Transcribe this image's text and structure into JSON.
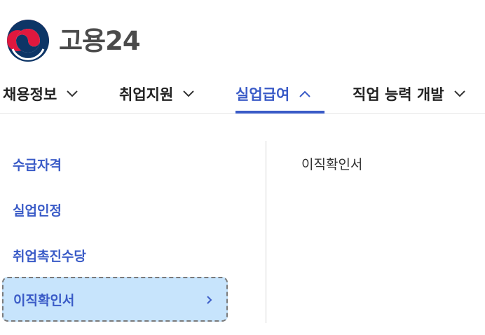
{
  "logo": {
    "text": "고용24"
  },
  "nav": {
    "items": [
      {
        "label": "채용정보",
        "icon": "chevron-down-icon"
      },
      {
        "label": "취업지원",
        "icon": "chevron-down-icon"
      },
      {
        "label": "실업급여",
        "icon": "chevron-up-icon"
      },
      {
        "label": "직업 능력 개발",
        "icon": "chevron-down-icon"
      }
    ],
    "active": "실업급여"
  },
  "submenu": {
    "items": [
      {
        "label": "수급자격"
      },
      {
        "label": "실업인정"
      },
      {
        "label": "취업촉진수당"
      },
      {
        "label": "이직확인서",
        "icon": "chevron-right-icon"
      }
    ],
    "selected": "이직확인서"
  },
  "depth3": {
    "items": [
      {
        "label": "이직확인서"
      }
    ]
  },
  "colors": {
    "accent": "#3a5bc7",
    "selected_bg": "#c7e4fc",
    "logo_red": "#e0183e",
    "logo_navy": "#0d3566"
  }
}
